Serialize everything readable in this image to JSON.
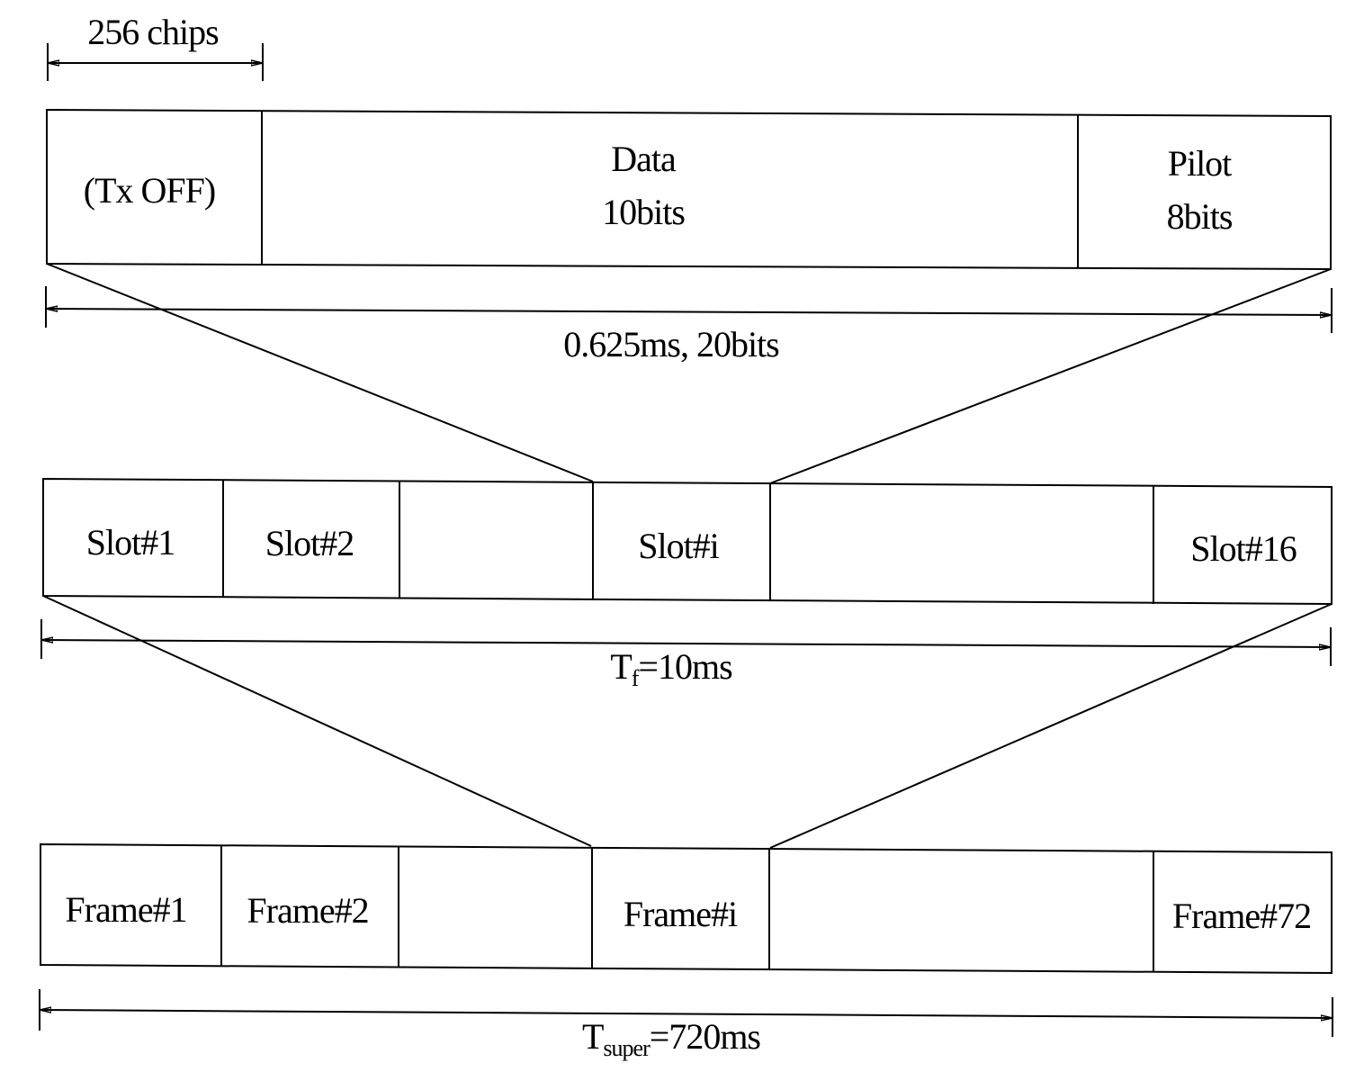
{
  "diagram": {
    "top_dimension": "256 chips",
    "slot_structure": {
      "fields": [
        {
          "name": "tx-off",
          "label": "(Tx OFF)"
        },
        {
          "name": "data",
          "label_line1": "Data",
          "label_line2": "10bits"
        },
        {
          "name": "pilot",
          "label_line1": "Pilot",
          "label_line2": "8bits"
        }
      ],
      "duration_label": "0.625ms, 20bits"
    },
    "frame_structure": {
      "slots": [
        "Slot#1",
        "Slot#2",
        "",
        "Slot#i",
        "",
        "Slot#16"
      ],
      "duration_symbol": "T",
      "duration_subscript": "f",
      "duration_value": "=10ms"
    },
    "superframe_structure": {
      "frames": [
        "Frame#1",
        "Frame#2",
        "",
        "Frame#i",
        "",
        "Frame#72"
      ],
      "duration_symbol": "T",
      "duration_subscript": "super",
      "duration_value": "=720ms"
    }
  }
}
